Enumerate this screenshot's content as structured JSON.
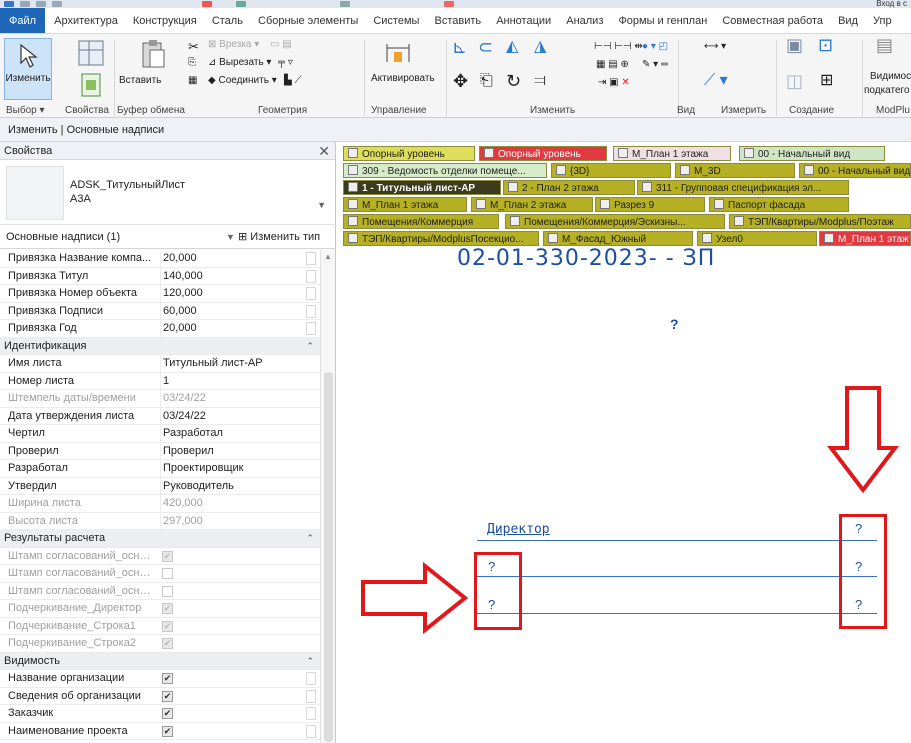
{
  "ribbon_tabs": [
    "Файл",
    "Архитектура",
    "Конструкция",
    "Сталь",
    "Сборные элементы",
    "Системы",
    "Вставить",
    "Аннотации",
    "Анализ",
    "Формы и генплан",
    "Совместная работа",
    "Вид",
    "Упр"
  ],
  "ribbon": {
    "modify_label": "Изменить",
    "paste_label": "Вставить",
    "cut_label": "Вырезать",
    "join_label": "Соединить",
    "cope_label": "Врезка",
    "activate_label": "Активировать",
    "visibility_label": "Видимос",
    "visibility_label2": "подкатего",
    "panels": {
      "select": "Выбор",
      "properties": "Свойства",
      "clipboard": "Буфер обмена",
      "geometry": "Геометрия",
      "control": "Управление",
      "modify": "Изменить",
      "view": "Вид",
      "measure": "Измерить",
      "create": "Создание",
      "modplus": "ModPlu"
    },
    "signin_label": "Вход в с"
  },
  "context_bar": "Изменить | Основные надписи",
  "properties": {
    "title": "Свойства",
    "type_name": "ADSK_ТитульныйЛист",
    "type_size": "А3А",
    "filter": "Основные надписи (1)",
    "edit_type": "Изменить тип",
    "rows": [
      {
        "kind": "prop",
        "name": "Привязка Название компа...",
        "value": "20,000"
      },
      {
        "kind": "prop",
        "name": "Привязка Титул",
        "value": "140,000"
      },
      {
        "kind": "prop",
        "name": "Привязка Номер объекта",
        "value": "120,000"
      },
      {
        "kind": "prop",
        "name": "Привязка Подписи",
        "value": "60,000"
      },
      {
        "kind": "prop",
        "name": "Привязка Год",
        "value": "20,000"
      },
      {
        "kind": "group",
        "name": "Идентификация"
      },
      {
        "kind": "prop",
        "name": "Имя листа",
        "value": "Титульный лист-АР"
      },
      {
        "kind": "prop",
        "name": "Номер листа",
        "value": "1"
      },
      {
        "kind": "dim",
        "name": "Штемпель даты/времени",
        "value": "03/24/22"
      },
      {
        "kind": "prop",
        "name": "Дата утверждения листа",
        "value": "03/24/22"
      },
      {
        "kind": "prop",
        "name": "Чертил",
        "value": "Разработал"
      },
      {
        "kind": "prop",
        "name": "Проверил",
        "value": "Проверил"
      },
      {
        "kind": "prop",
        "name": "Разработал",
        "value": "Проектировщик"
      },
      {
        "kind": "prop",
        "name": "Утвердил",
        "value": "Руководитель"
      },
      {
        "kind": "dim",
        "name": "Ширина листа",
        "value": "420,000"
      },
      {
        "kind": "dim",
        "name": "Высота листа",
        "value": "297,000"
      },
      {
        "kind": "group",
        "name": "Результаты расчета"
      },
      {
        "kind": "dimcheck",
        "name": "Штамп согласований_осн_2...",
        "checked": true
      },
      {
        "kind": "dimcheck",
        "name": "Штамп согласований_осн_4...",
        "checked": false
      },
      {
        "kind": "dimcheck",
        "name": "Штамп согласований_осн_6...",
        "checked": false
      },
      {
        "kind": "dimcheck",
        "name": "Подчеркивание_Директор",
        "checked": true
      },
      {
        "kind": "dimcheck",
        "name": "Подчеркивание_Строка1",
        "checked": true
      },
      {
        "kind": "dimcheck",
        "name": "Подчеркивание_Строка2",
        "checked": true
      },
      {
        "kind": "group",
        "name": "Видимость"
      },
      {
        "kind": "check",
        "name": "Название организации",
        "checked": true
      },
      {
        "kind": "check",
        "name": "Сведения об организации",
        "checked": true
      },
      {
        "kind": "check",
        "name": "Заказчик",
        "checked": true
      },
      {
        "kind": "check",
        "name": "Наименование проекта",
        "checked": true
      }
    ]
  },
  "doc_tabs": [
    {
      "label": "Опорный уровень",
      "bg": "#dede5a"
    },
    {
      "label": "Опорный уровень",
      "bg": "#e0393f"
    },
    {
      "label": "М_План 1 этажа",
      "bg": "#f1dfe6"
    },
    {
      "label": "00 - Начальный вид",
      "bg": "#cfe6c4"
    },
    {
      "label": "309 - Ведомость отделки помеще...",
      "bg": "#d6ebc8"
    },
    {
      "label": "{3D}",
      "bg": "#b6b024"
    },
    {
      "label": "М_3D",
      "bg": "#b6b024"
    },
    {
      "label": "00 - Начальный вид",
      "bg": "#b6b024"
    },
    {
      "label": "1 - Титульный лист-АР",
      "bg": "#3b3b1e"
    },
    {
      "label": "2 - План 2 этажа",
      "bg": "#b6b024"
    },
    {
      "label": "311 - Групповая спецификация эл...",
      "bg": "#b6b024"
    },
    {
      "label": "М_План 1 этажа",
      "bg": "#b6b024"
    },
    {
      "label": "М_План 2 этажа",
      "bg": "#b6b024"
    },
    {
      "label": "Разрез 9",
      "bg": "#b6b024"
    },
    {
      "label": "Паспорт фасада",
      "bg": "#b6b024"
    },
    {
      "label": "Помещения/Коммерция",
      "bg": "#b6b024"
    },
    {
      "label": "Помещения/Коммерция/Эскизны...",
      "bg": "#b6b024"
    },
    {
      "label": "ТЭП/Квартиры/Modplus/Поэтаж",
      "bg": "#b6b024"
    },
    {
      "label": "ТЭП/Квартиры/ModplusПосекцио...",
      "bg": "#b6b024"
    },
    {
      "label": "М_Фасад_Южный",
      "bg": "#b6b024"
    },
    {
      "label": "Узел0",
      "bg": "#b6b024"
    },
    {
      "label": "М_План 1 этаж",
      "bg": "#e0393f"
    }
  ],
  "sheet": {
    "number_text": "02-01-330-2023- - ЗП",
    "question_mark": "?",
    "director_label": "Директор"
  },
  "colors": {
    "annotation_red": "#e0181c",
    "drawing_blue": "#1c4fa0",
    "file_tab": "#1e66b8"
  }
}
